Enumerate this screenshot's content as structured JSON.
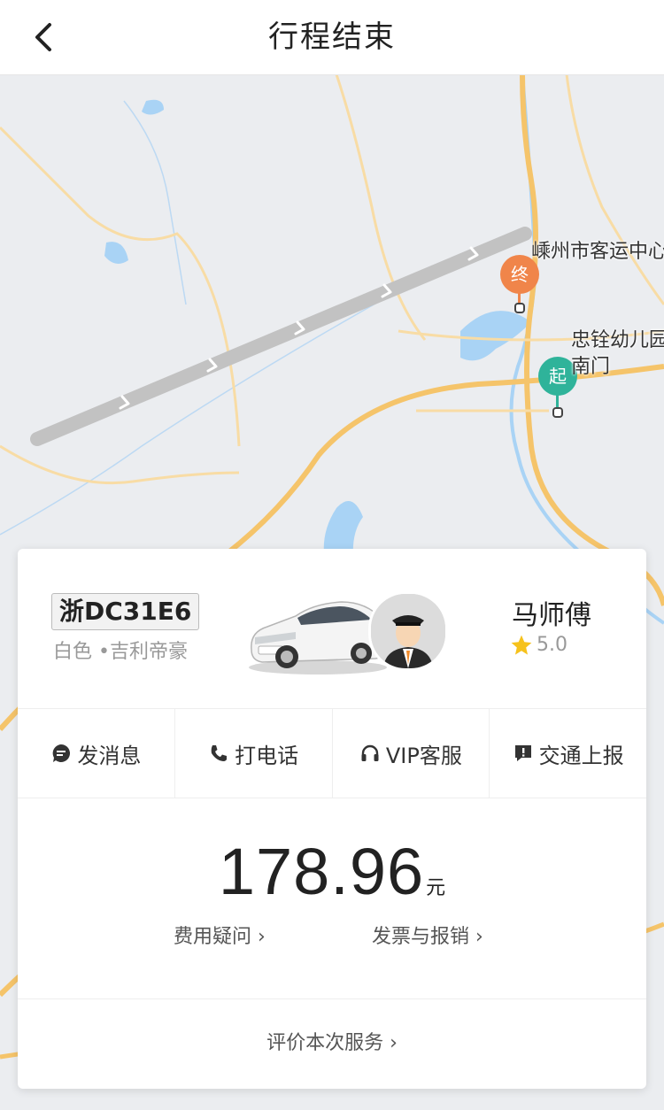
{
  "header": {
    "title": "行程结束"
  },
  "map": {
    "end_pin": "终",
    "start_pin": "起",
    "end_label": "嵊州市客运中心",
    "start_label_line1": "忠铨幼儿园",
    "start_label_line2": "南门"
  },
  "driver": {
    "plate": "浙DC31E6",
    "car_info": "白色 •吉利帝豪",
    "name": "马师傅",
    "rating": "5.0"
  },
  "actions": [
    {
      "label": "发消息",
      "icon": "message-icon"
    },
    {
      "label": "打电话",
      "icon": "phone-icon"
    },
    {
      "label": "VIP客服",
      "icon": "headset-icon"
    },
    {
      "label": "交通上报",
      "icon": "report-icon"
    }
  ],
  "fare": {
    "amount": "178.96",
    "unit": "元",
    "question": "费用疑问 ›",
    "invoice": "发票与报销 ›"
  },
  "rate_service": "评价本次服务 ›",
  "colors": {
    "end_pin": "#f0854a",
    "start_pin": "#2fb39a",
    "route": "#c2c2c2",
    "road": "#f5c46a"
  }
}
